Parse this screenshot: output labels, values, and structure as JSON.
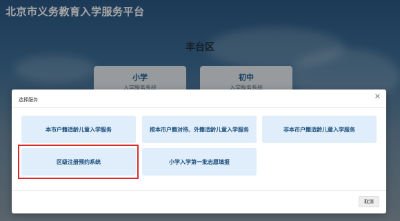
{
  "site": {
    "title": "北京市义务教育入学服务平台"
  },
  "background": {
    "district": "丰台区",
    "cards": [
      {
        "title": "小学",
        "subtitle": "入学服务系统"
      },
      {
        "title": "初中",
        "subtitle": "入学服务系统"
      }
    ]
  },
  "modal": {
    "title": "选择服务",
    "close_icon": "×",
    "services": [
      {
        "label": "本市户籍适龄儿童入学服务"
      },
      {
        "label": "按本市户籍对待、外籍适龄儿童入学服务"
      },
      {
        "label": "非本市户籍适龄儿童入学服务"
      },
      {
        "label": "区级注册预约系统"
      },
      {
        "label": "小学入学第一批志愿填报"
      }
    ],
    "cancel_label": "取消"
  },
  "colors": {
    "accent": "#1d4e7e",
    "service_bg": "#dfeefa",
    "highlight": "#d82a2a"
  }
}
